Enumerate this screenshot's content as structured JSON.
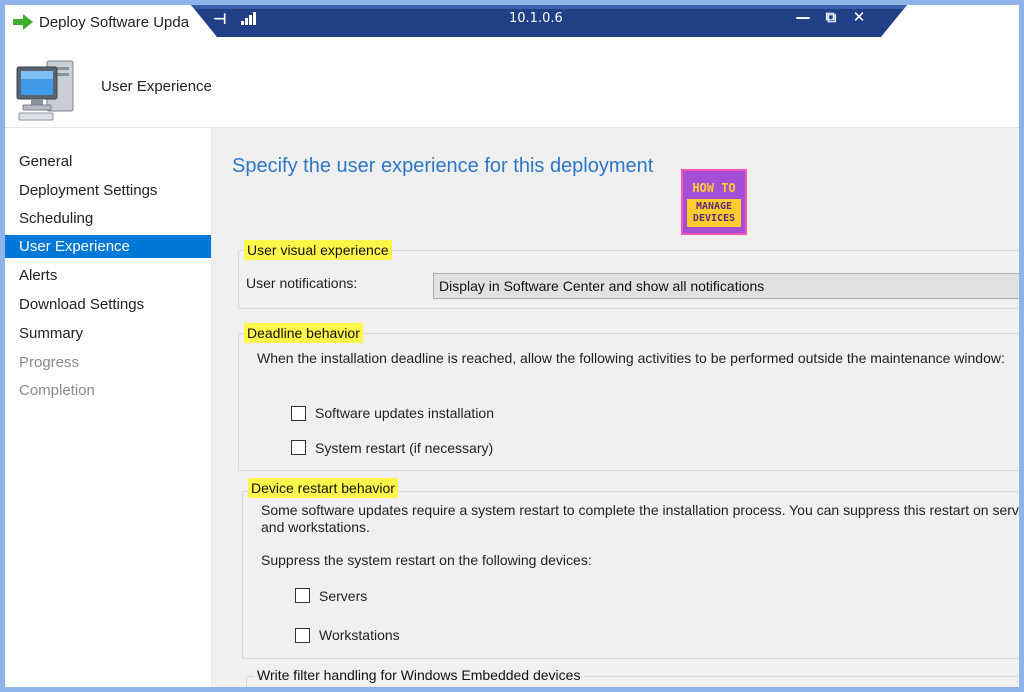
{
  "window": {
    "title": "Deploy Software Upda",
    "connection_ip": "10.1.0.6",
    "pin_glyph": "⊣",
    "minimize_glyph": "—",
    "restore_glyph": "⧉",
    "close_glyph": "✕"
  },
  "header": {
    "title": "User Experience"
  },
  "nav": {
    "items": [
      {
        "label": "General",
        "state": "normal"
      },
      {
        "label": "Deployment Settings",
        "state": "normal"
      },
      {
        "label": "Scheduling",
        "state": "normal"
      },
      {
        "label": "User Experience",
        "state": "active"
      },
      {
        "label": "Alerts",
        "state": "normal"
      },
      {
        "label": "Download Settings",
        "state": "normal"
      },
      {
        "label": "Summary",
        "state": "normal"
      },
      {
        "label": "Progress",
        "state": "disabled"
      },
      {
        "label": "Completion",
        "state": "disabled"
      }
    ]
  },
  "content": {
    "page_title": "Specify the user experience for this deployment",
    "logo": {
      "line1": "HOW TO",
      "line2": "MANAGE",
      "line3": "DEVICES"
    },
    "visual_group": {
      "legend": "User visual experience",
      "notifications_label": "User notifications:",
      "notifications_value": "Display in Software Center and show all notifications"
    },
    "deadline_group": {
      "legend": "Deadline behavior",
      "description": "When the installation deadline is reached, allow the following activities to be performed outside the maintenance window:",
      "options": [
        {
          "label": "Software updates installation",
          "checked": false
        },
        {
          "label": "System restart (if necessary)",
          "checked": false
        }
      ]
    },
    "restart_group": {
      "legend": "Device restart behavior",
      "description_line1": "Some software updates require a system restart to complete the installation process. You can suppress this restart on servers",
      "description_line2": "and workstations.",
      "suppress_label": "Suppress the system restart on the following devices:",
      "options": [
        {
          "label": "Servers",
          "checked": false
        },
        {
          "label": "Workstations",
          "checked": false
        }
      ]
    },
    "write_filter_group": {
      "legend": "Write filter handling for Windows Embedded devices"
    }
  },
  "colors": {
    "accent": "#0078d7",
    "title_blue": "#2d77c8",
    "highlight": "#fff84a",
    "rdp_bar": "#1f3f86"
  }
}
